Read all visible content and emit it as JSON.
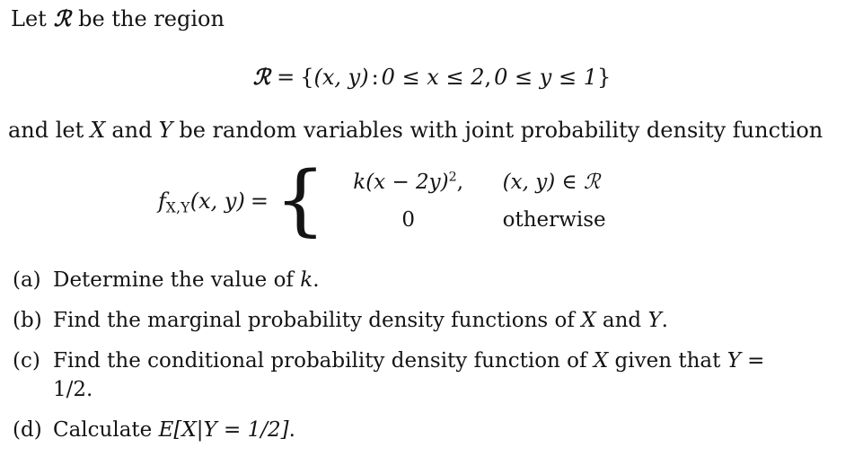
{
  "document": {
    "type": "math-problem",
    "background_color": "#ffffff",
    "text_color": "#141414",
    "intro": {
      "before_symbol": "Let",
      "region_symbol": "ℛ",
      "after_symbol": "be the region"
    },
    "region_equation": {
      "lhs": "ℛ",
      "equals": "=",
      "open_brace": "{",
      "tuple": "(x, y)",
      "colon": ":",
      "bound_x": "0 ≤ x ≤ 2",
      "comma": ",",
      "bound_y": "0 ≤ y ≤ 1",
      "close_brace": "}",
      "full_text": "ℛ = {(x, y) : 0 ≤ x ≤ 2, 0 ≤ y ≤ 1}"
    },
    "rv_sentence": {
      "part1": "and let",
      "var_x": "X",
      "part2": "and",
      "var_y": "Y",
      "part3": "be random variables with joint probability density function",
      "full_text": "and let X and Y be random variables with joint probability density function"
    },
    "pdf_definition": {
      "function_name": "f",
      "function_subscript": "X,Y",
      "arguments": "(x, y)",
      "equals": "=",
      "brace": "{",
      "cases": [
        {
          "value_prefix": "k(x − 2y)",
          "value_exponent": "2",
          "value_suffix": ",",
          "value_full": "k(x − 2y)²,",
          "condition": "(x, y) ∈ ℛ",
          "condition_style": "math"
        },
        {
          "value_prefix": "0",
          "value_exponent": "",
          "value_suffix": "",
          "value_full": "0",
          "condition": "otherwise",
          "condition_style": "text"
        }
      ]
    },
    "questions": [
      {
        "label": "(a)",
        "lines": [
          "Determine the value of k."
        ],
        "text": "Determine the value of k."
      },
      {
        "label": "(b)",
        "lines": [
          "Find the marginal probability density functions of X and Y."
        ],
        "text": "Find the marginal probability density functions of X and Y."
      },
      {
        "label": "(c)",
        "lines": [
          "Find the conditional probability density function of X given that Y =",
          "1/2."
        ],
        "text": "Find the conditional probability density function of X given that Y = 1/2."
      },
      {
        "label": "(d)",
        "lines": [
          "Calculate E[X|Y = 1/2]."
        ],
        "text": "Calculate E[X|Y = 1/2]."
      }
    ]
  }
}
